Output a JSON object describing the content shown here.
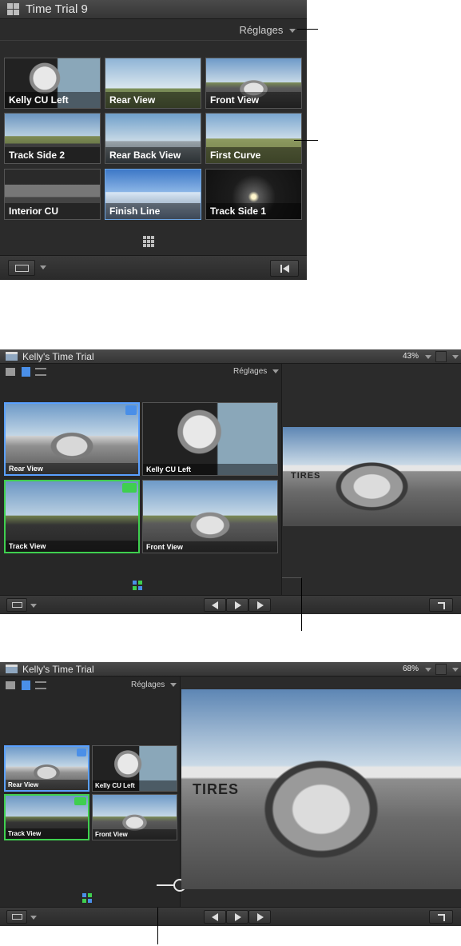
{
  "panel1": {
    "title": "Time Trial 9",
    "settings_label": "Réglages",
    "angles": [
      {
        "label": "Kelly CU Left"
      },
      {
        "label": "Rear View"
      },
      {
        "label": "Front View"
      },
      {
        "label": "Track Side 2"
      },
      {
        "label": "Rear Back View"
      },
      {
        "label": "First Curve"
      },
      {
        "label": "Interior CU"
      },
      {
        "label": "Finish Line"
      },
      {
        "label": "Track Side 1"
      }
    ]
  },
  "panel2": {
    "title": "Kelly's Time Trial",
    "zoom": "43%",
    "settings_label": "Réglages",
    "angles": [
      {
        "label": "Rear View"
      },
      {
        "label": "Kelly CU Left"
      },
      {
        "label": "Track View"
      },
      {
        "label": "Front View"
      }
    ],
    "viewer_sign": "TIRES"
  },
  "panel3": {
    "title": "Kelly's Time Trial",
    "zoom": "68%",
    "settings_label": "Réglages",
    "angles": [
      {
        "label": "Rear View"
      },
      {
        "label": "Kelly CU Left"
      },
      {
        "label": "Track View"
      },
      {
        "label": "Front View"
      }
    ],
    "viewer_sign": "TIRES"
  },
  "colors": {
    "video_selected": "#5aa0ff",
    "audio_selected": "#3fcf4f",
    "panel_bg": "#2b2b2b"
  }
}
